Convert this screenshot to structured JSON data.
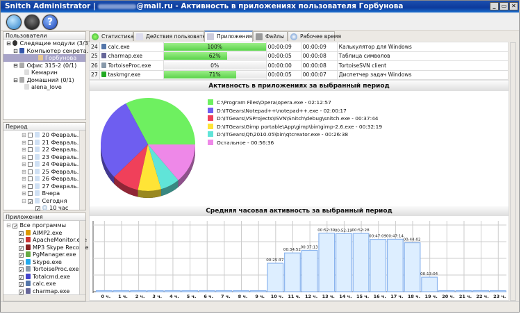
{
  "window": {
    "app": "Snitch Administrator |",
    "email_suffix": "@mail.ru",
    "title_rest": " - Активность в приложениях пользователя Горбунова",
    "min": "_",
    "restore": "▭",
    "close": "✕"
  },
  "toolbar": [
    {
      "icon": "refresh-icon"
    },
    {
      "icon": "spy-icon"
    },
    {
      "icon": "help-icon"
    }
  ],
  "users": {
    "header": "Пользователи",
    "items": [
      "Следящие модули (3/3)",
      "Компьютер секрета...",
      "Горбунова",
      "Офис 315-2 (0/1)",
      "Кемарин",
      "Домашний (0/1)",
      "alena_love"
    ]
  },
  "period": {
    "header": "Период",
    "items": [
      "20 Февраль...",
      "21 Февраль...",
      "22 Февраль...",
      "23 Февраль...",
      "24 Февраль...",
      "25 Февраль...",
      "26 Февраль...",
      "27 Февраль...",
      "Вчера",
      "Сегодня",
      "10 час"
    ]
  },
  "apps": {
    "header": "Приложения",
    "items": [
      "Все программы",
      "AIMP2.exe",
      "ApacheMonitor.exe",
      "MP3 Skype Recorder",
      "PgManager.exe",
      "Skype.exe",
      "TortoiseProc.exe",
      "Totalcmd.exe",
      "calc.exe",
      "charmap.exe"
    ]
  },
  "tabs": [
    "Статистика",
    "Действия пользователя",
    "Приложения",
    "Файлы",
    "Рабочее время"
  ],
  "table": [
    {
      "n": "24",
      "name": "calc.exe",
      "pct": 100,
      "pct_label": "100%",
      "t1": "00:00:09",
      "t2": "00:00:09",
      "desc": "Калькулятор для Windows"
    },
    {
      "n": "25",
      "name": "charmap.exe",
      "pct": 62,
      "pct_label": "62%",
      "t1": "00:00:05",
      "t2": "00:00:08",
      "desc": "Таблица символов"
    },
    {
      "n": "26",
      "name": "TortoiseProc.exe",
      "pct": 0,
      "pct_label": "0%",
      "t1": "00:00:00",
      "t2": "00:00:08",
      "desc": "TortoiseSVN client"
    },
    {
      "n": "27",
      "name": "taskmgr.exe",
      "pct": 71,
      "pct_label": "71%",
      "t1": "00:00:05",
      "t2": "00:00:07",
      "desc": "Диспетчер задач Windows"
    }
  ],
  "pie": {
    "title": "Активность в приложениях за выбранный период",
    "slices": [
      {
        "label": "C:\\Program Files\\Opera\\opera.exe - 02:12:57",
        "seconds": 7977,
        "color": "#6ef060"
      },
      {
        "label": "D:\\ITGears\\Notepad++\\notepad++.exe - 02:00:17",
        "seconds": 7217,
        "color": "#6e5ef0"
      },
      {
        "label": "D:\\ITGears\\VSProjects\\ISVN\\Snitch\\debug\\snitch.exe - 00:37:44",
        "seconds": 2264,
        "color": "#f0405a"
      },
      {
        "label": "D:\\ITGears\\Gimp portable\\App\\gimp\\bin\\gimp-2.6.exe - 00:32:19",
        "seconds": 1939,
        "color": "#ffe436"
      },
      {
        "label": "D:\\ITGears\\Qt\\2010.05\\bin\\qtcreator.exe - 00:26:38",
        "seconds": 1598,
        "color": "#60e4d8"
      },
      {
        "label": "Остальное - 00:56:36",
        "seconds": 3396,
        "color": "#ee88e8"
      }
    ]
  },
  "chart_data": {
    "type": "bar",
    "title": "Средняя часовая активность за выбранный период",
    "categories": [
      "0 ч.",
      "1 ч.",
      "2 ч.",
      "3 ч.",
      "4 ч.",
      "5 ч.",
      "6 ч.",
      "7 ч.",
      "8 ч.",
      "9 ч.",
      "10 ч.",
      "11 ч.",
      "12 ч.",
      "13 ч.",
      "14 ч.",
      "15 ч.",
      "16 ч.",
      "17 ч.",
      "18 ч.",
      "19 ч.",
      "20 ч.",
      "21 ч.",
      "22 ч.",
      "23 ч."
    ],
    "values_minutes": [
      0,
      0,
      0,
      0,
      0,
      0,
      0,
      0,
      0,
      0,
      25.62,
      34.87,
      37.22,
      52.65,
      52.32,
      52.47,
      47.15,
      47.23,
      44.03,
      13.07,
      0,
      0,
      0,
      0
    ],
    "labels": [
      "",
      "",
      "",
      "",
      "",
      "",
      "",
      "",
      "",
      "",
      "00:25:37",
      "00:34:52",
      "00:37:13",
      "00:52:39",
      "00:52:19",
      "00:52:28",
      "00:47:09",
      "00:47:14",
      "00:44:02",
      "00:13:04",
      "",
      "",
      "",
      ""
    ],
    "ylim": [
      0,
      60
    ],
    "grid": true,
    "bar_color": "#ddeeff",
    "bar_edge": "#8ab4ee"
  }
}
